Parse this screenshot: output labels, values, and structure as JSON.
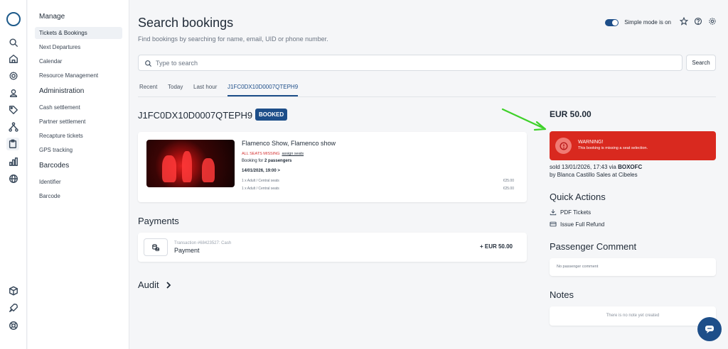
{
  "sidebar": {
    "sections": [
      {
        "title": "Manage",
        "items": [
          "Tickets & Bookings",
          "Next Departures",
          "Calendar",
          "Resource Management"
        ]
      },
      {
        "title": "Administration",
        "items": [
          "Cash settlement",
          "Partner settlement",
          "Recapture tickets",
          "GPS tracking"
        ]
      },
      {
        "title": "Barcodes",
        "items": [
          "Identifier",
          "Barcode"
        ]
      }
    ]
  },
  "header": {
    "title": "Search bookings",
    "subtitle": "Find bookings by searching for name, email, UID or phone number.",
    "simple_mode_label": "Simple mode is on"
  },
  "search": {
    "placeholder": "Type to search",
    "button": "Search"
  },
  "tabs": [
    "Recent",
    "Today",
    "Last hour",
    "J1FC0DX10D0007QTEPH9"
  ],
  "booking": {
    "id": "J1FC0DX10D0007QTEPH9",
    "status": "BOOKED",
    "show_title": "Flamenco Show, Flamenco show",
    "seats_missing": "ALL SEATS MISSING",
    "assign_seats": "assign seats",
    "booking_for_prefix": "Booking for",
    "booking_for_count": "2 passengers",
    "date": "14/01/2026, 19:00 >",
    "lines": [
      {
        "desc": "1 x Adult / Central seats",
        "price": "€25.00"
      },
      {
        "desc": "1 x Adult / Central seats",
        "price": "€25.00"
      }
    ]
  },
  "payments": {
    "title": "Payments",
    "transaction": "Transaction #68423527: Cash",
    "label": "Payment",
    "amount": "+ EUR 50.00"
  },
  "audit": {
    "title": "Audit"
  },
  "summary": {
    "amount": "EUR 50.00",
    "warning_title": "WARNING!",
    "warning_desc": "This booking is missing a seat selection.",
    "sold_prefix": "sold 13/01/2026, 17:43 via",
    "sold_channel": "BOXOFC",
    "sold_by": "by Blanca Castillo Sales at Cibeles"
  },
  "quick_actions": {
    "title": "Quick Actions",
    "items": [
      "PDF Tickets",
      "Issue Full Refund"
    ]
  },
  "passenger_comment": {
    "title": "Passenger Comment",
    "text": "No passenger comment"
  },
  "notes": {
    "title": "Notes",
    "text": "There is no note yet created"
  },
  "colors": {
    "accent": "#1d4e89",
    "warning": "#d9291f",
    "arrow": "#3fd12a"
  }
}
